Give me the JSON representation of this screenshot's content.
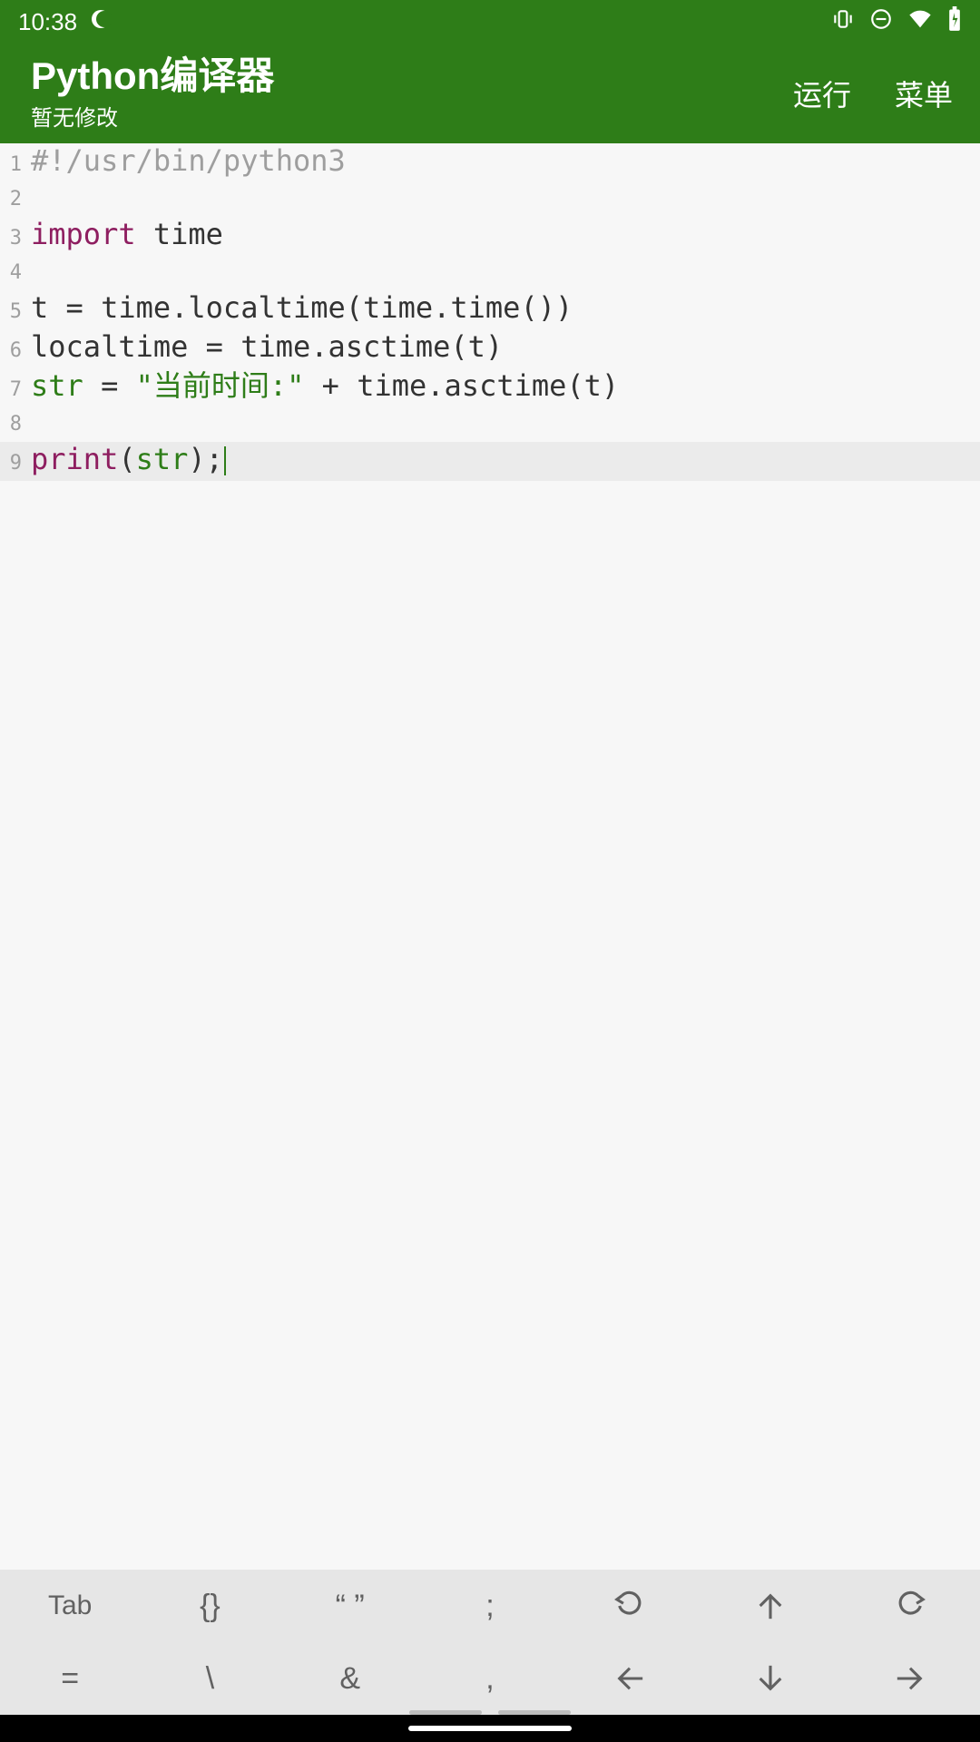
{
  "status": {
    "time": "10:38",
    "icons": [
      "moon-icon",
      "vibrate-icon",
      "dnd-icon",
      "wifi-icon",
      "battery-icon"
    ]
  },
  "header": {
    "title": "Python编译器",
    "subtitle": "暂无修改",
    "actions": {
      "run": "运行",
      "menu": "菜单"
    }
  },
  "code": {
    "lines": [
      {
        "n": 1,
        "tokens": [
          [
            "comment",
            "#!/usr/bin/python3"
          ]
        ]
      },
      {
        "n": 2,
        "tokens": []
      },
      {
        "n": 3,
        "tokens": [
          [
            "keyword",
            "import"
          ],
          [
            "text",
            " time"
          ]
        ]
      },
      {
        "n": 4,
        "tokens": []
      },
      {
        "n": 5,
        "tokens": [
          [
            "text",
            "t = time.localtime(time.time())"
          ]
        ]
      },
      {
        "n": 6,
        "tokens": [
          [
            "text",
            "localtime = time.asctime(t)"
          ]
        ]
      },
      {
        "n": 7,
        "tokens": [
          [
            "var",
            "str"
          ],
          [
            "text",
            " = "
          ],
          [
            "string",
            "\"当前时间:\""
          ],
          [
            "text",
            " + time.asctime(t)"
          ]
        ]
      },
      {
        "n": 8,
        "tokens": []
      },
      {
        "n": 9,
        "tokens": [
          [
            "keyword",
            "print"
          ],
          [
            "text",
            "("
          ],
          [
            "var",
            "str"
          ],
          [
            "text",
            ");"
          ]
        ],
        "current": true,
        "cursor": true
      }
    ]
  },
  "toolbar": {
    "row1": [
      "Tab",
      "{}",
      "“ ”",
      ";",
      "undo-icon",
      "arrow-up-icon",
      "redo-icon"
    ],
    "row2": [
      "=",
      "\\",
      "&",
      ",",
      "arrow-left-icon",
      "arrow-down-icon",
      "arrow-right-icon"
    ]
  }
}
